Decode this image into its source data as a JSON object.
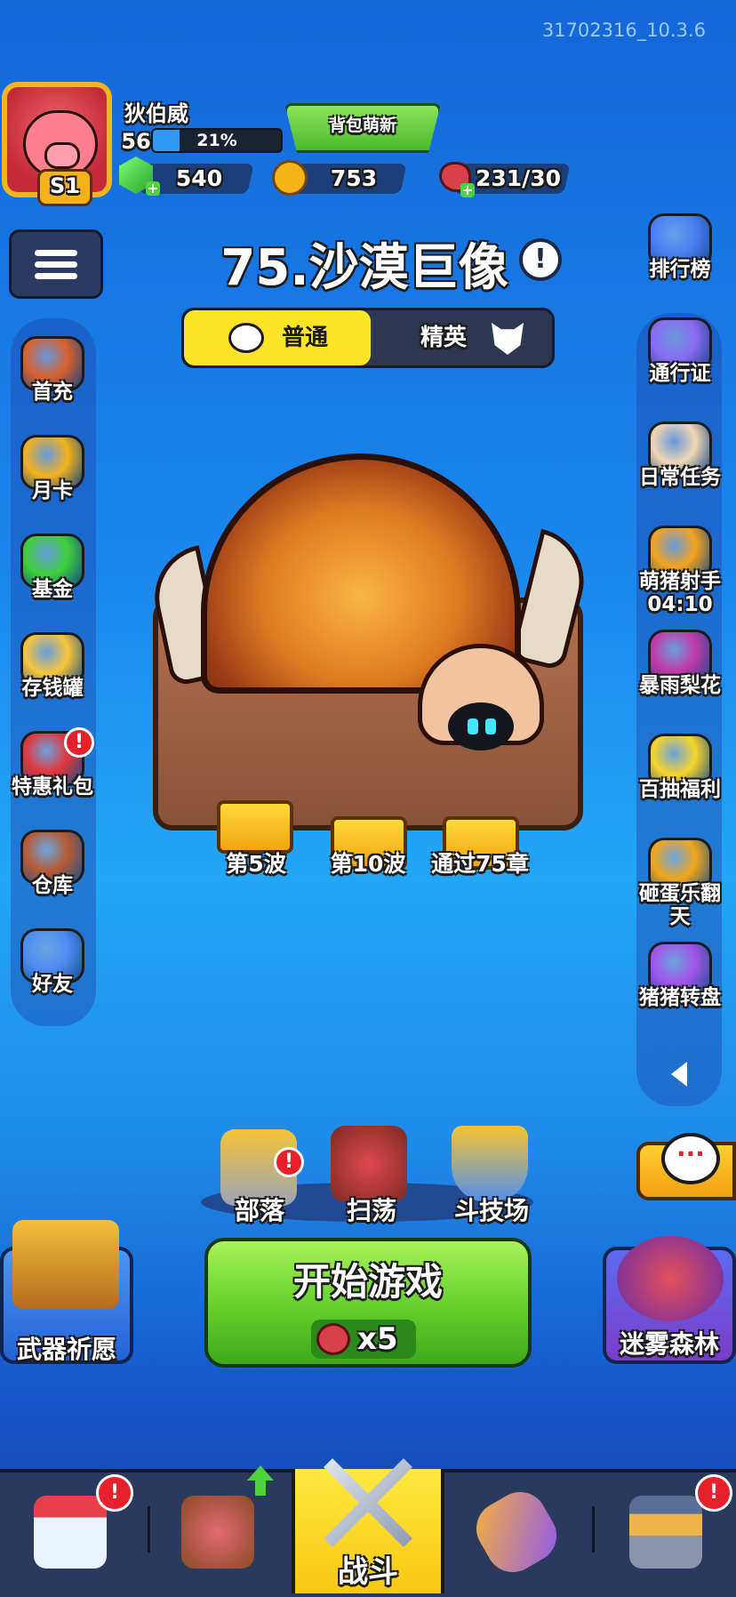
{
  "version": "31702316_10.3.6",
  "player": {
    "name": "狄伯威",
    "level": "56",
    "xp_percent_label": "21%",
    "xp_fraction": 0.21,
    "season_badge": "S1"
  },
  "header": {
    "new_button_label": "背包萌新",
    "gems": "540",
    "coins": "753",
    "stamina": "231/30"
  },
  "left_menu": [
    {
      "label": "首充",
      "icon": "first-recharge-icon",
      "color": "#d8612c"
    },
    {
      "label": "月卡",
      "icon": "monthly-card-icon",
      "color": "#f3b21c"
    },
    {
      "label": "基金",
      "icon": "fund-gem-icon",
      "color": "#3ed03a"
    },
    {
      "label": "存钱罐",
      "icon": "piggy-bank-icon",
      "color": "#f8c53a"
    },
    {
      "label": "特惠礼包",
      "icon": "gift-pack-icon",
      "color": "#e4353a",
      "badge": "!"
    },
    {
      "label": "仓库",
      "icon": "backpack-icon",
      "color": "#b85a34"
    },
    {
      "label": "好友",
      "icon": "friends-icon",
      "color": "#4c8df3"
    }
  ],
  "right_menu": [
    {
      "label": "排行榜",
      "icon": "leaderboard-icon",
      "color": "#4b7ef2"
    },
    {
      "label": "通行证",
      "icon": "pass-badge-icon",
      "color": "#8b6cf2"
    },
    {
      "label": "日常任务",
      "icon": "daily-scroll-icon",
      "color": "#f0d6b2"
    },
    {
      "label": "萌猪射手",
      "sub": "04:10",
      "icon": "pig-archer-icon",
      "color": "#f5a31c"
    },
    {
      "label": "暴雨梨花",
      "icon": "arrow-rain-icon",
      "color": "#c23aa8"
    },
    {
      "label": "百抽福利",
      "icon": "crown-welfare-icon",
      "color": "#f8d42a"
    },
    {
      "label": "砸蛋乐翻天",
      "icon": "egg-hammer-icon",
      "color": "#f2a519"
    },
    {
      "label": "猪猪转盘",
      "icon": "wheel-icon",
      "color": "#a155e8"
    }
  ],
  "stage": {
    "title": "75.沙漠巨像",
    "info_glyph": "!",
    "mode_normal": "普通",
    "mode_elite": "精英",
    "rewards": [
      "第5波",
      "第10波",
      "通过75章"
    ]
  },
  "hub": [
    {
      "label": "部落",
      "icon": "tribe-castle-icon",
      "badge": "!"
    },
    {
      "label": "扫荡",
      "icon": "sweep-pig-icon"
    },
    {
      "label": "斗技场",
      "icon": "arena-shield-icon"
    }
  ],
  "start": {
    "label": "开始游戏",
    "cost": "x5"
  },
  "side_cards": {
    "left": "武器祈愿",
    "right": "迷雾森林"
  },
  "chat_glyph": "···",
  "nav": {
    "active_label": "战斗",
    "badge": "!"
  }
}
